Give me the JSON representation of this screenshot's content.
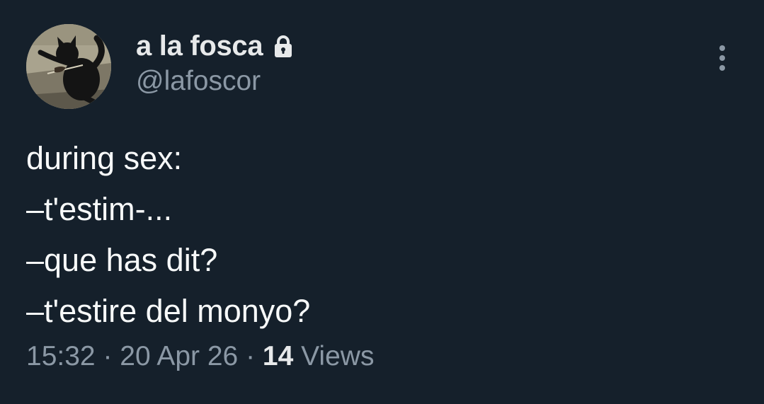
{
  "author": {
    "display_name": "a la fosca",
    "handle": "@lafoscor",
    "protected_icon": "lock-icon",
    "avatar_description": "black-cat-playing-violin"
  },
  "menu": {
    "icon": "more-vertical-icon"
  },
  "tweet": {
    "lines": [
      "during sex:",
      "–t'estim-...",
      "–que has dit?",
      "–t'estire del monyo?"
    ]
  },
  "meta": {
    "time": "15:32",
    "separator": "·",
    "date": "20 Apr 26",
    "views_count": "14",
    "views_label": "Views"
  },
  "colors": {
    "background": "#15202b",
    "text_primary": "#e7e9ea",
    "text_secondary": "#8b98a5"
  }
}
